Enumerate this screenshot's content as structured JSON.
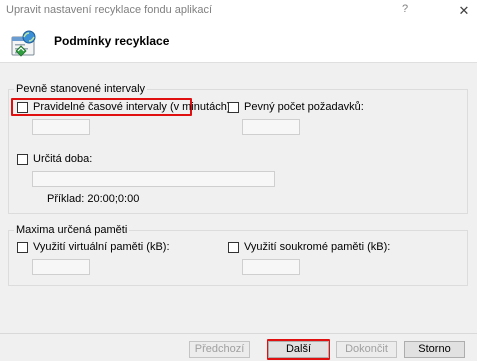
{
  "window": {
    "title": "Upravit nastavení recyklace fondu aplikací",
    "help_glyph": "?",
    "close_glyph": "✕"
  },
  "header": {
    "heading": "Podmínky recyklace"
  },
  "fixed_intervals": {
    "group_label": "Pevně stanovené intervaly",
    "regular_intervals_label": "Pravidelné časové intervaly (v minutách):",
    "regular_intervals_checked": false,
    "regular_intervals_value": "",
    "request_count_label": "Pevný počet požadavků:",
    "request_count_checked": false,
    "request_count_value": "",
    "specific_time_label": "Určitá doba:",
    "specific_time_checked": false,
    "specific_time_value": "",
    "example_text": "Příklad: 20:00;0:00"
  },
  "memory_limits": {
    "group_label": "Maxima určená paměti",
    "virtual_memory_label": "Využití virtuální paměti (kB):",
    "virtual_memory_checked": false,
    "virtual_memory_value": "",
    "private_memory_label": "Využití soukromé paměti (kB):",
    "private_memory_checked": false,
    "private_memory_value": ""
  },
  "footer": {
    "previous_label": "Předchozí",
    "next_label": "Další",
    "finish_label": "Dokončit",
    "cancel_label": "Storno"
  },
  "colors": {
    "highlight": "#e01010",
    "panel": "#f0f0f0"
  },
  "icons": {
    "header": "recycle-app-pool-icon"
  }
}
